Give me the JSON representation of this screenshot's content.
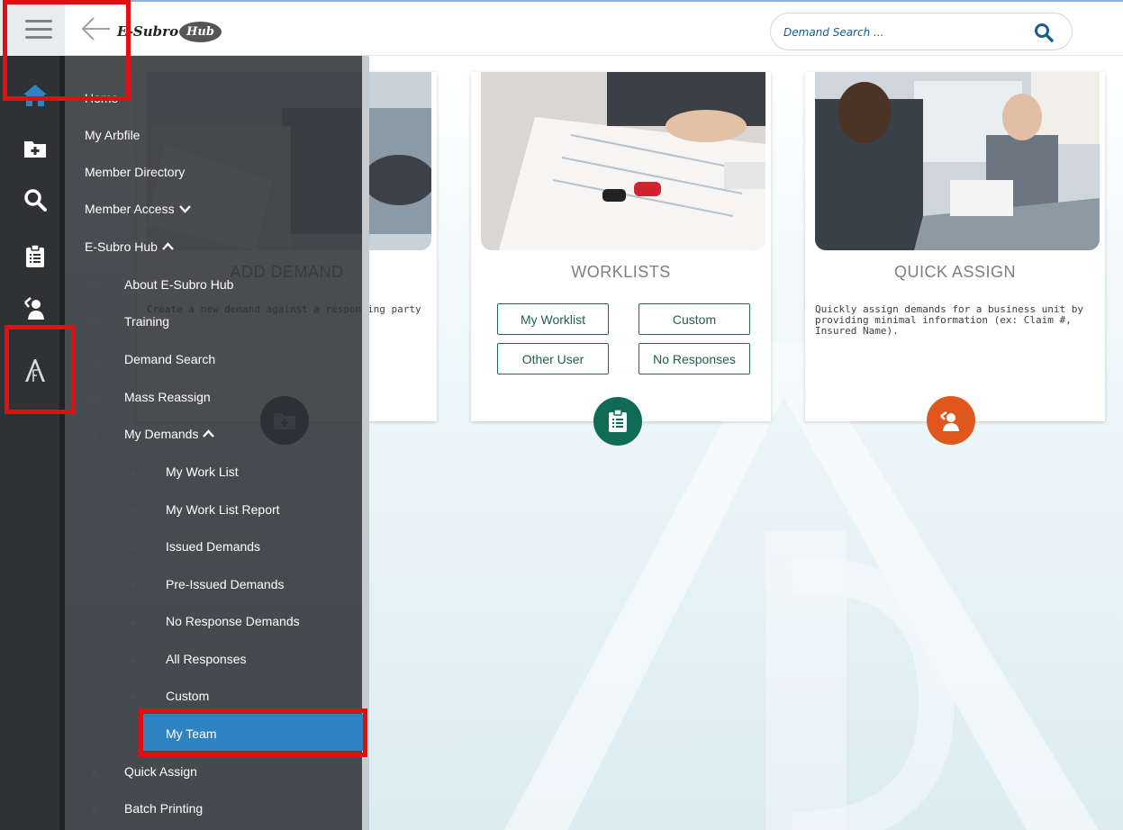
{
  "header": {
    "logo_prefix": "E-Subro",
    "logo_suffix": "Hub",
    "search_placeholder": "Demand Search ..."
  },
  "menu": {
    "items": [
      {
        "label": "Home"
      },
      {
        "label": "My Arbfile"
      },
      {
        "label": "Member Directory"
      },
      {
        "label": "Member Access"
      },
      {
        "label": "E-Subro Hub"
      },
      {
        "label": "About E-Subro Hub"
      },
      {
        "label": "Training"
      },
      {
        "label": "Demand Search"
      },
      {
        "label": "Mass Reassign"
      },
      {
        "label": "My Demands"
      },
      {
        "label": "My Work List"
      },
      {
        "label": "My Work List Report"
      },
      {
        "label": "Issued Demands"
      },
      {
        "label": "Pre-Issued Demands"
      },
      {
        "label": "No Response Demands"
      },
      {
        "label": "All Responses"
      },
      {
        "label": "Custom"
      },
      {
        "label": "My Team"
      },
      {
        "label": "Quick Assign"
      },
      {
        "label": "Batch Printing"
      }
    ],
    "active_item": "My Team"
  },
  "cards": {
    "add_demand": {
      "title": "ADD DEMAND",
      "description": "Create a new demand against a responding party"
    },
    "worklists": {
      "title": "WORKLISTS",
      "buttons": [
        "My Worklist",
        "Custom",
        "Other User",
        "No Responses"
      ]
    },
    "quick_assign": {
      "title": "QUICK ASSIGN",
      "description": "Quickly assign demands for a business unit by providing minimal information (ex: Claim #, Insured Name)."
    }
  },
  "colors": {
    "accent_blue": "#2e83c1",
    "worklist_green": "#1e6b5b",
    "quick_assign_orange": "#e0571e",
    "callout_red": "#e01010"
  }
}
